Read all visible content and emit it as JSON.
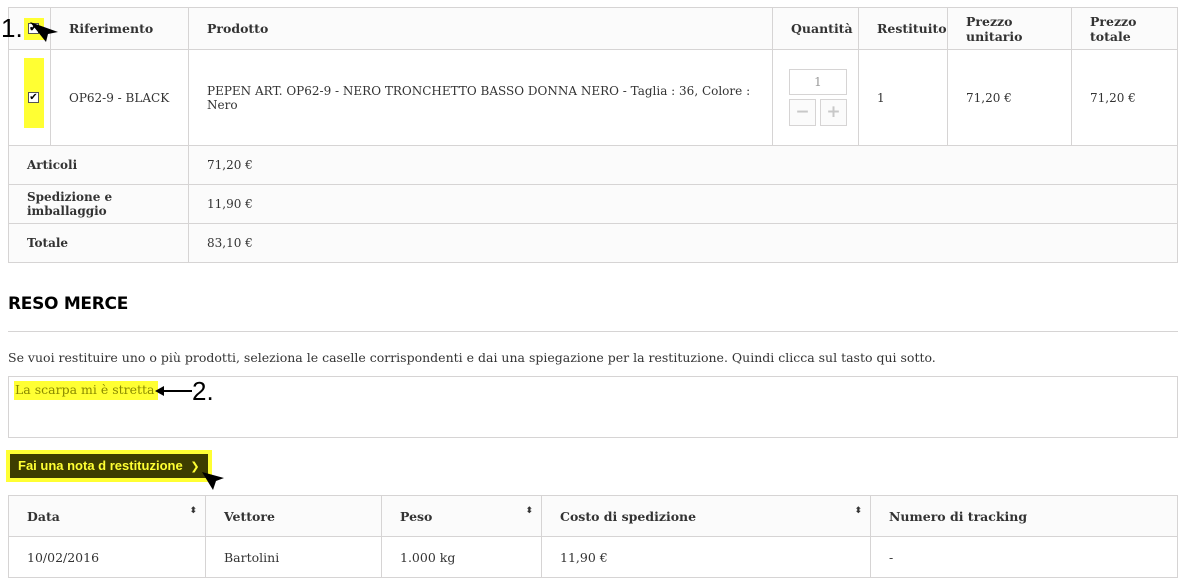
{
  "order": {
    "headers": [
      "Riferimento",
      "Prodotto",
      "Quantità",
      "Restituito",
      "Prezzo unitario",
      "Prezzo totale"
    ],
    "header_checkbox": "✔",
    "row": {
      "checkbox": "✔",
      "reference": "OP62-9 - BLACK",
      "product": "PEPEN ART. OP62-9 - NERO TRONCHETTO BASSO DONNA NERO - Taglia : 36, Colore : Nero",
      "quantity": "1",
      "qty_minus": "−",
      "qty_plus": "+",
      "returned": "1",
      "unit_price": "71,20 €",
      "total_price": "71,20 €"
    },
    "summary": [
      {
        "label": "Articoli",
        "value": "71,20 €"
      },
      {
        "label": "Spedizione e imballaggio",
        "value": "11,90 €"
      },
      {
        "label": "Totale",
        "value": "83,10 €"
      }
    ]
  },
  "annotations": {
    "step1": "1.",
    "step2": "2."
  },
  "return_section": {
    "title": "RESO MERCE",
    "info": "Se vuoi restituire uno o più prodotti, seleziona le caselle corrispondenti e dai una spiegazione per la restituzione. Quindi clicca sul tasto qui sotto.",
    "reason": "La scarpa mi è stretta",
    "submit_label": "Fai una nota d restituzione",
    "submit_chevron": "❯"
  },
  "shipping": {
    "headers": [
      "Data",
      "Vettore",
      "Peso",
      "Costo di spedizione",
      "Numero di tracking"
    ],
    "sort_icon": "⬍",
    "row": [
      "10/02/2016",
      "Bartolini",
      "1.000 kg",
      "11,90 €",
      "-"
    ]
  },
  "colors": {
    "highlight": "#ffff33",
    "border": "#d6d4d4",
    "button_dark": "#3d3d00"
  }
}
